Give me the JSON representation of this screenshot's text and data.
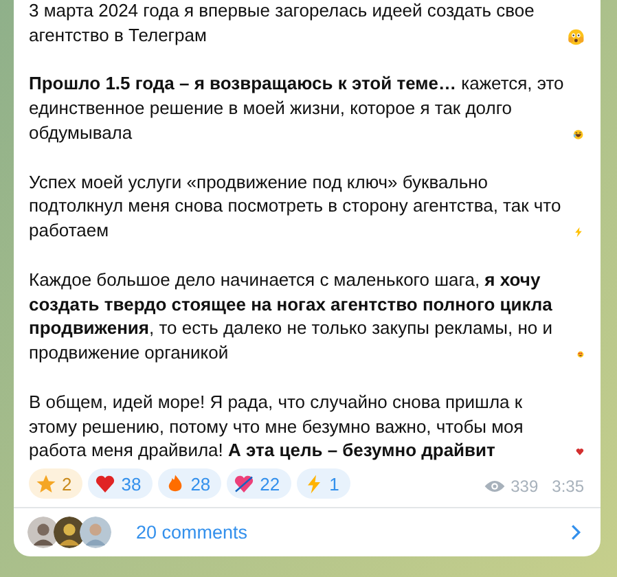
{
  "post": {
    "paragraphs": [
      "3 марта 2024 года я впервые загорелась идеей создать свое агентство в Телеграм",
      "**Прошло 1.5 года – я возвращаюсь к этой теме…** кажется, это единственное решение в моей жизни, которое я так долго обдумывала",
      "Успех моей услуги «продвижение под ключ» буквально подтолкнул меня снова посмотреть в сторону агентства, так что работаем",
      "Каждое большое дело начинается с маленького шага, **я хочу создать твердо стоящее на ногах агентство полного цикла продвижения**, то есть далеко не только закупы рекламы, но и продвижение органикой",
      "В общем, идей море! Я рада, что случайно снова пришла к этому решению, потому что мне безумно важно, чтобы моя работа меня драйвила! **А эта цель – безумно драйвит**"
    ],
    "reactions": [
      {
        "kind": "paid",
        "count": "2"
      },
      {
        "kind": "regular",
        "count": "38"
      },
      {
        "kind": "regular",
        "count": "28"
      },
      {
        "kind": "regular",
        "count": "22"
      },
      {
        "kind": "regular",
        "count": "1"
      }
    ],
    "views": "339",
    "time": "3:35"
  },
  "comments": {
    "label": "20 comments"
  }
}
